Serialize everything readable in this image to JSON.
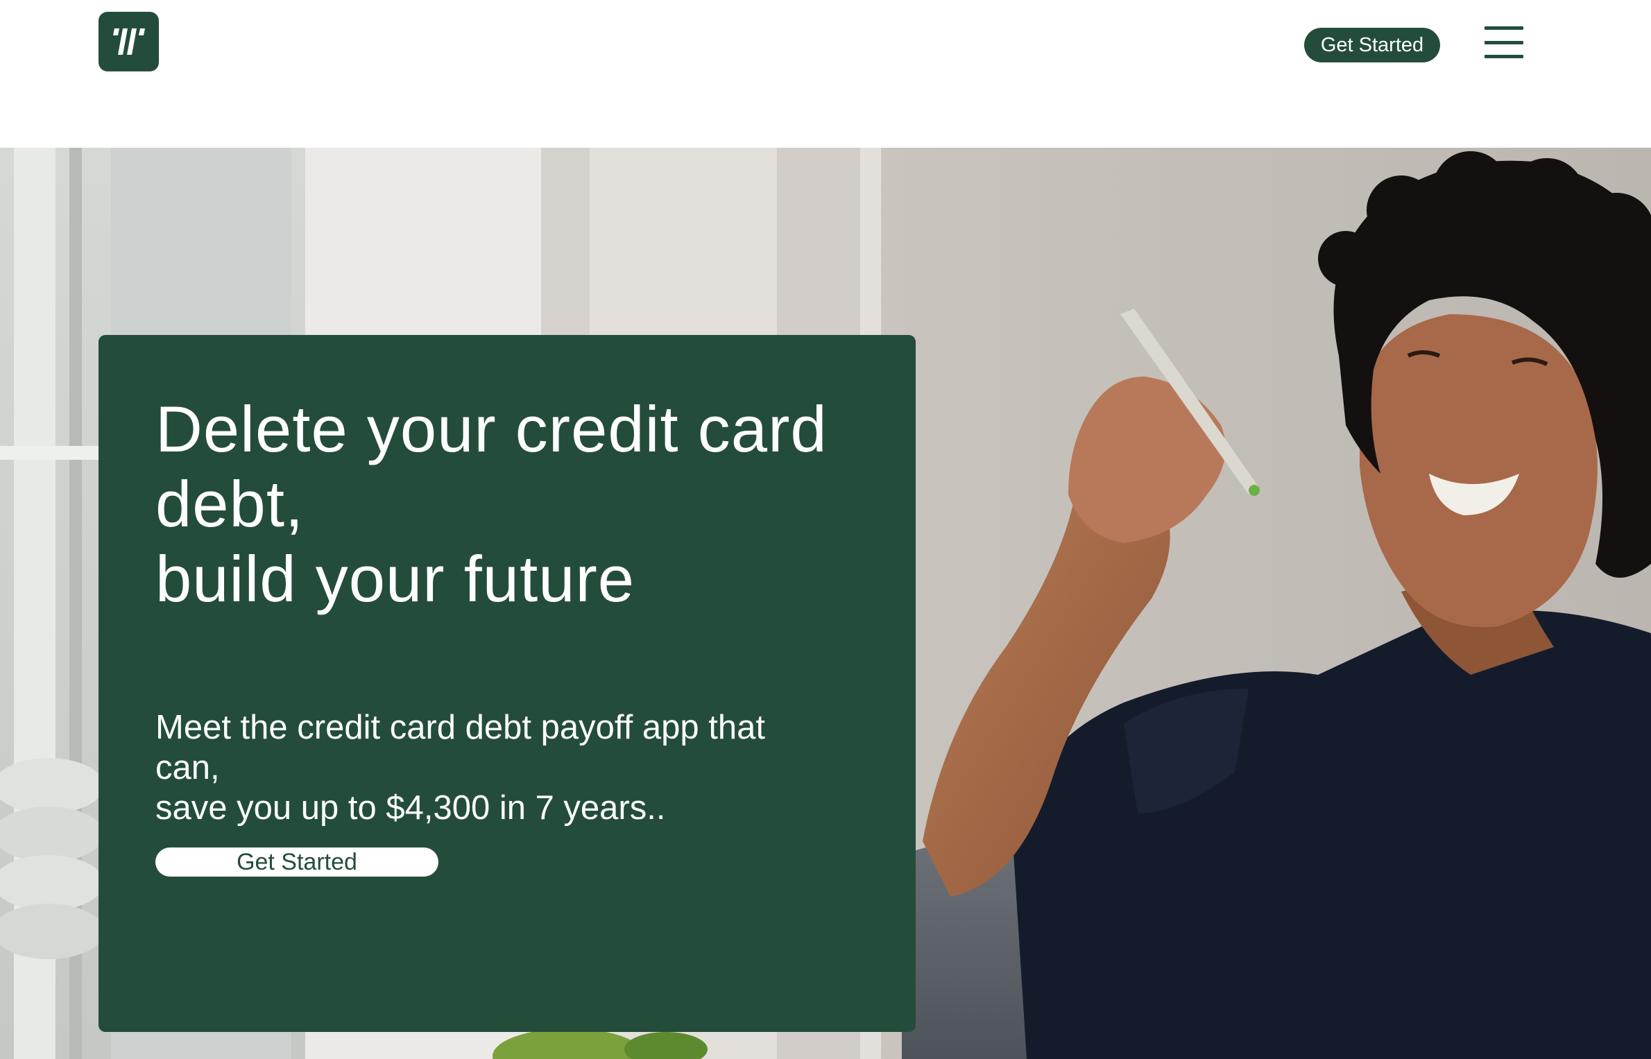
{
  "header": {
    "logo_icon": "brand-logo-icon",
    "get_started_label": "Get Started",
    "menu_icon": "hamburger-menu-icon"
  },
  "hero": {
    "headline_lines": [
      "Delete your credit card",
      "debt,",
      "build your future"
    ],
    "subhead_lines": [
      "Meet the credit card debt payoff app that",
      "can,",
      "save you up to $4,300 in 7 years.."
    ],
    "cta_label": "Get Started",
    "background_image": "woman-smiling-holding-pen-photo"
  },
  "colors": {
    "brand_green": "#234d3a",
    "white": "#ffffff"
  }
}
